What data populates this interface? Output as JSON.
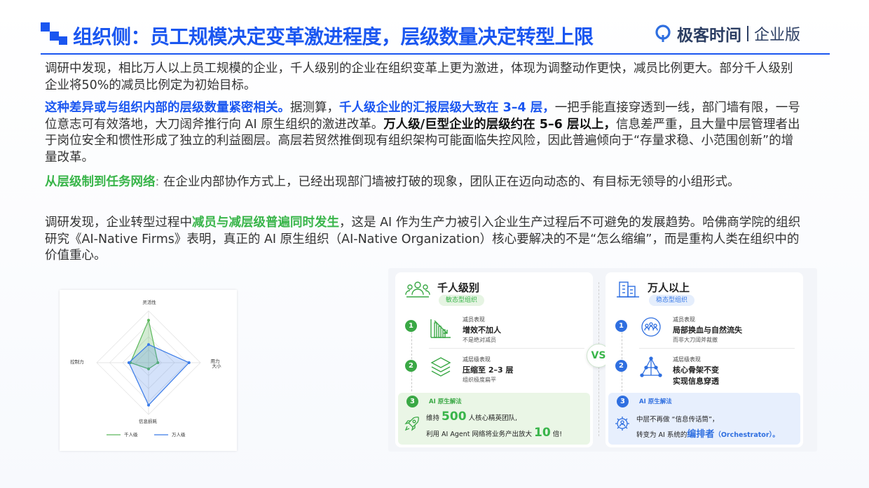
{
  "header": {
    "title": "组织侧：员工规模决定变革激进程度，层级数量决定转型上限",
    "brand_name": "极客时间",
    "brand_sub": "企业版"
  },
  "paragraphs": {
    "p1": {
      "text": "调研中发现，相比万人以上员工规模的企业，千人级别的企业在组织变革上更为激进，体现为调整动作更快，减员比例更大。部分千人级别企业将50%的减员比例定为初始目标。"
    },
    "p2": {
      "s1": "这种差异或与组织内部的层级数量紧密相关。",
      "s2": "据测算，",
      "s3": "千人级企业的汇报层级大致在 3–4 层，",
      "s4": "一把手能直接穿透到一线，部门墙有限，一号位意志可有效落地，大刀阔斧推行向 AI 原生组织的激进改革。",
      "s5": "万人级/巨型企业的层级约在 5–6 层以上，",
      "s6": "信息差严重，且大量中层管理者出于岗位安全和惯性形成了独立的利益圈层。高层若贸然推倒现有组织架构可能面临失控风险，因此普遍倾向于“存量求稳、小范围创新”的增量改革。"
    },
    "p3": {
      "s1": "从层级制到任务网络",
      "s2": ":",
      "s3": " 在企业内部协作方式上，已经出现部门墙被打破的现象，团队正在迈向动态的、有目标无领导的小组形式。"
    },
    "p4": {
      "s1": "调研发现，企业转型过程中",
      "s2": "减员与减层级普遍同时发生",
      "s3": "，这是 AI 作为生产力被引入企业生产过程后不可避免的发展趋势。哈佛商学院的组织研究《AI-Native Firms》表明，真正的 AI 原生组织（AI-Native Organization）核心要解决的不是“怎么缩编”，而是重构人类在组织中的价值重心。"
    }
  },
  "radar": {
    "axes": [
      "灵活性",
      "用力\n大小",
      "信息损耗",
      "控制力"
    ],
    "axis_top": "灵活性",
    "axis_right_1": "用力",
    "axis_right_2": "大小",
    "axis_bottom": "信息损耗",
    "axis_left": "控制力",
    "legend_green": "千人级",
    "legend_blue": "万人级",
    "color_green": "#5cb85c",
    "color_blue": "#3a7be8",
    "series": [
      {
        "name": "千人级",
        "values": [
          0.82,
          0.18,
          0.12,
          0.35
        ]
      },
      {
        "name": "万人级",
        "values": [
          0.35,
          0.78,
          0.82,
          0.38
        ]
      }
    ]
  },
  "compare": {
    "vs": "VS",
    "left": {
      "title": "千人级别",
      "tag": "敏态型组织",
      "row1": {
        "num": "1",
        "small": "减员表现",
        "main": "增效不加人",
        "sub": "不是绝对减员"
      },
      "row2": {
        "num": "2",
        "small": "减层级表现",
        "main": "压缩至 2–3 层",
        "sub": "组织极度扁平"
      },
      "sol": {
        "num": "3",
        "label": "AI 原生解法",
        "t1a": "维持 ",
        "t1b": "500",
        "t1c": " 人核心精英团队,",
        "t2a": "利用 AI Agent 网络将业务产出放大 ",
        "t2b": "10",
        "t2c": " 倍!"
      }
    },
    "right": {
      "title": "万人以上",
      "tag": "稳态型组织",
      "row1": {
        "num": "1",
        "small": "减员表现",
        "main": "局部换血与自然流失",
        "sub": "而非大刀阔斧裁撤"
      },
      "row2": {
        "num": "2",
        "small": "减层级表现",
        "main": "核心骨架不变",
        "main2": "实现信息穿透"
      },
      "sol": {
        "num": "3",
        "label": "AI 原生解法",
        "t1": "中层不再做 “信息传话筒”，",
        "t2a": "转变为 AI 系统的",
        "t2b": "编排者",
        "t2c": "（Orchestrator）。"
      }
    }
  }
}
